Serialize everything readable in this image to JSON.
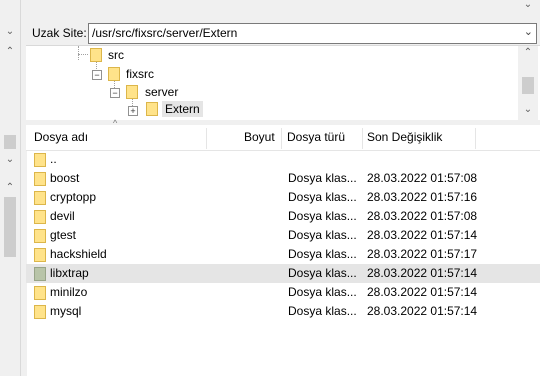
{
  "remote_site": {
    "label": "Uzak Site:",
    "path": "/usr/src/fixsrc/server/Extern"
  },
  "tree": {
    "nodes": [
      {
        "label": "src"
      },
      {
        "label": "fixsrc"
      },
      {
        "label": "server"
      },
      {
        "label": "Extern"
      }
    ]
  },
  "file_list": {
    "columns": {
      "name": "Dosya adı",
      "size": "Boyut",
      "type": "Dosya türü",
      "modified": "Son Değişiklik"
    },
    "parent_label": "..",
    "rows": [
      {
        "name": "boost",
        "size": "",
        "type": "Dosya klas...",
        "modified": "28.03.2022 01:57:08"
      },
      {
        "name": "cryptopp",
        "size": "",
        "type": "Dosya klas...",
        "modified": "28.03.2022 01:57:16"
      },
      {
        "name": "devil",
        "size": "",
        "type": "Dosya klas...",
        "modified": "28.03.2022 01:57:08"
      },
      {
        "name": "gtest",
        "size": "",
        "type": "Dosya klas...",
        "modified": "28.03.2022 01:57:14"
      },
      {
        "name": "hackshield",
        "size": "",
        "type": "Dosya klas...",
        "modified": "28.03.2022 01:57:17"
      },
      {
        "name": "libxtrap",
        "size": "",
        "type": "Dosya klas...",
        "modified": "28.03.2022 01:57:14"
      },
      {
        "name": "minilzo",
        "size": "",
        "type": "Dosya klas...",
        "modified": "28.03.2022 01:57:14"
      },
      {
        "name": "mysql",
        "size": "",
        "type": "Dosya klas...",
        "modified": "28.03.2022 01:57:14"
      }
    ]
  },
  "icons": {
    "folder": "folder-icon",
    "dropdown": "chevron-down-icon",
    "scroll_up": "chevron-up-icon",
    "scroll_down": "chevron-down-icon",
    "sort": "sort-ascending-icon",
    "expand": "plus-icon",
    "collapse": "minus-icon"
  },
  "colors": {
    "folder_fill": "#ffe38a",
    "folder_border": "#dcb64a",
    "selected_row": "#e5e5e5",
    "panel_bg": "#f0f0f0"
  }
}
